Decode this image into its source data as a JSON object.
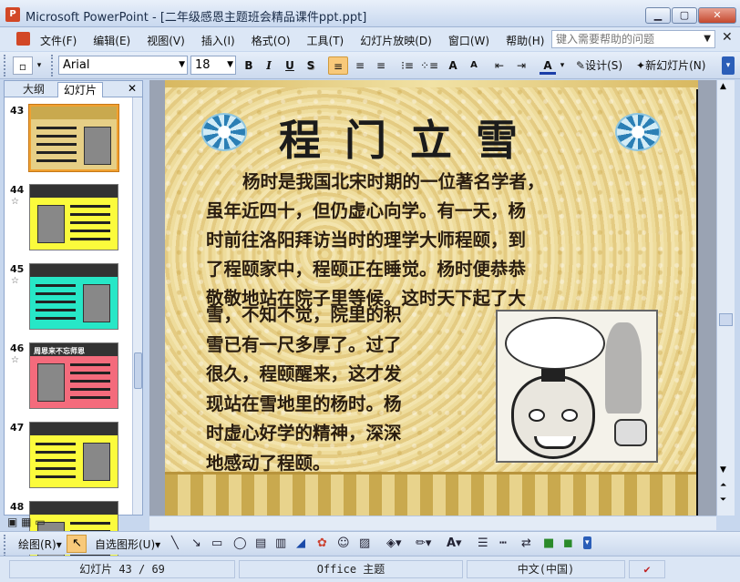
{
  "window": {
    "title": "Microsoft PowerPoint - [二年级感恩主题班会精品课件ppt.ppt]",
    "app_icon": "powerpoint-icon",
    "min_label": "▁",
    "max_label": "▢",
    "close_label": "✕"
  },
  "menu": {
    "items": [
      "文件(F)",
      "编辑(E)",
      "视图(V)",
      "插入(I)",
      "格式(O)",
      "工具(T)",
      "幻灯片放映(D)",
      "窗口(W)",
      "帮助(H)"
    ],
    "help_placeholder": "键入需要帮助的问题",
    "close": "✕"
  },
  "toolbar": {
    "font_name": "Arial",
    "font_size": "18",
    "bold": "B",
    "italic": "I",
    "underline": "U",
    "shadow": "S",
    "grow_font": "A",
    "shrink_font": "A",
    "font_color": "A",
    "design_label": "设计(S)",
    "new_slide_label": "新幻灯片(N)"
  },
  "panel": {
    "tab_outline": "大纲",
    "tab_slides": "幻灯片",
    "close": "✕",
    "thumbs": [
      {
        "num": "43",
        "selected": true,
        "bg": "#e6cf86",
        "title": "",
        "star": false
      },
      {
        "num": "44",
        "selected": false,
        "bg": "#fbfb3c",
        "title": "",
        "star": true
      },
      {
        "num": "45",
        "selected": false,
        "bg": "#27e7c7",
        "title": "",
        "star": true
      },
      {
        "num": "46",
        "selected": false,
        "bg": "#f46b7c",
        "title": "周恩来不忘师恩",
        "star": true
      },
      {
        "num": "47",
        "selected": false,
        "bg": "#fbfb3c",
        "title": "",
        "star": false
      },
      {
        "num": "48",
        "selected": false,
        "bg": "#fbfb3c",
        "title": "",
        "star": false
      }
    ],
    "star_icon": "☆"
  },
  "slide": {
    "heading": "程门立雪",
    "paragraph_lines": [
      "杨时是我国北宋时期的一位著名学者，",
      "虽年近四十，但仍虚心向学。有一天，杨",
      "时前往洛阳拜访当时的理学大师程颐，到",
      "了程颐家中，程颐正在睡觉。杨时便恭恭",
      "敬敬地站在院子里等候。这时天下起了大"
    ],
    "paragraph2_lines": [
      "雪，不知不觉，院里的积",
      "雪已有一尺多厚了。过了",
      "很久，程颐醒来，这才发",
      "现站在雪地里的杨时。杨",
      "时虚心好学的精神，深深",
      "地感动了程颐。"
    ]
  },
  "drawbar": {
    "draw_label": "绘图(R)",
    "autoshape_label": "自选图形(U)"
  },
  "status": {
    "slide_info": "幻灯片 43 / 69",
    "theme": "Office 主题",
    "language": "中文(中国)"
  },
  "colors": {
    "selection": "#f8c97a",
    "chrome": "#dce7f6"
  }
}
